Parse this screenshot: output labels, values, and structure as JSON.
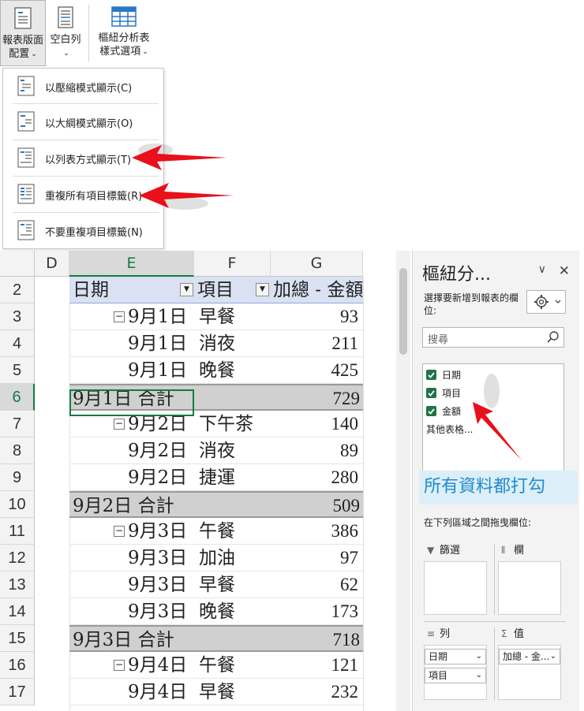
{
  "ribbon": {
    "report_layout_label_1": "報表版面",
    "report_layout_label_2": "配置",
    "blank_rows_label": "空白列",
    "pivot_style_options_label_1": "樞紐分析表",
    "pivot_style_options_label_2": "樣式選項"
  },
  "menu": {
    "items": [
      {
        "label": "以壓縮模式顯示(C)"
      },
      {
        "label": "以大綱模式顯示(O)"
      },
      {
        "label": "以列表方式顯示(T)"
      },
      {
        "label": "重複所有項目標籤(R)"
      },
      {
        "label": "不要重複項目標籤(N)"
      }
    ]
  },
  "sheet": {
    "columns": [
      "D",
      "E",
      "F",
      "G"
    ],
    "header": {
      "date": "日期",
      "item": "項目",
      "sum": "加總 - 金額"
    },
    "rows": [
      {
        "n": "3",
        "date": "9月1日",
        "item": "早餐",
        "val": "93",
        "first": true
      },
      {
        "n": "4",
        "date": "9月1日",
        "item": "消夜",
        "val": "211"
      },
      {
        "n": "5",
        "date": "9月1日",
        "item": "晚餐",
        "val": "425"
      },
      {
        "n": "6",
        "subtotal": "9月1日 合計",
        "val": "729"
      },
      {
        "n": "7",
        "date": "9月2日",
        "item": "下午茶",
        "val": "140",
        "first": true
      },
      {
        "n": "8",
        "date": "9月2日",
        "item": "消夜",
        "val": "89"
      },
      {
        "n": "9",
        "date": "9月2日",
        "item": "捷運",
        "val": "280"
      },
      {
        "n": "10",
        "subtotal": "9月2日 合計",
        "val": "509"
      },
      {
        "n": "11",
        "date": "9月3日",
        "item": "午餐",
        "val": "386",
        "first": true
      },
      {
        "n": "12",
        "date": "9月3日",
        "item": "加油",
        "val": "97"
      },
      {
        "n": "13",
        "date": "9月3日",
        "item": "早餐",
        "val": "62"
      },
      {
        "n": "14",
        "date": "9月3日",
        "item": "晚餐",
        "val": "173"
      },
      {
        "n": "15",
        "subtotal": "9月3日 合計",
        "val": "718"
      },
      {
        "n": "16",
        "date": "9月4日",
        "item": "午餐",
        "val": "121",
        "first": true
      },
      {
        "n": "17",
        "date": "9月4日",
        "item": "早餐",
        "val": "232"
      }
    ],
    "header_row_number": "2",
    "collapse_symbol": "−"
  },
  "pane": {
    "title": "樞紐分...",
    "hint": "選擇要新增到報表的欄位:",
    "search_placeholder": "搜尋",
    "fields": [
      {
        "label": "日期"
      },
      {
        "label": "項目"
      },
      {
        "label": "金額"
      }
    ],
    "more_tables": "其他表格...",
    "callout": "所有資料都打勾",
    "drag_hint": "在下列區域之間拖曳欄位:",
    "zones": {
      "filter": "篩選",
      "columns": "欄",
      "rows": "列",
      "values": "值"
    },
    "row_items": [
      "日期",
      "項目"
    ],
    "value_items": [
      "加總 - 金..."
    ]
  },
  "colors": {
    "excel_green": "#107c41",
    "header_blue": "#d9e1f2",
    "subtotal_gray": "#d0d0d0",
    "arrow_red": "#e8101a",
    "callout_bg": "#dceff8",
    "callout_text": "#1f8bcf"
  }
}
